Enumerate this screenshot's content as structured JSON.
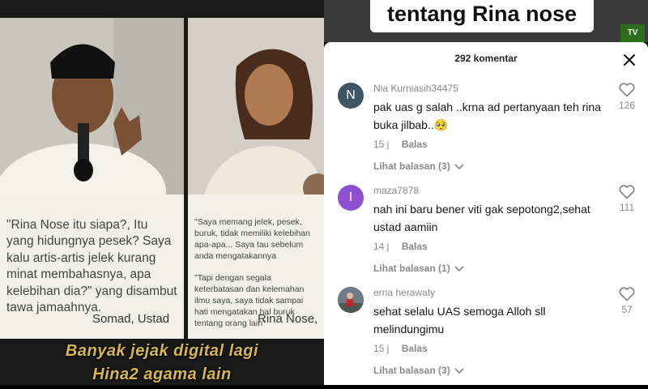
{
  "video": {
    "left_caption": "\"Rina Nose itu siapa?, Itu yang hidungnya pesek? Saya kalu artis-artis jelek kurang minat membahasnya, apa kelebihan dia?\" yang disambut tawa jamaahnya.",
    "left_credit": "Somad, Ustad",
    "right_caption_1": "\"Saya memang jelek, pesek, buruk, tidak memiliki kelebihan apa-apa... Saya tau sebelum anda mengatakannya",
    "right_caption_2": "\"Tapi dengan segala keterbatasan dan kelemahan ilmu saya, saya tidak sampai hati mengatakan hal buruk tentang orang lain\"",
    "right_credit": "Rina Nose,",
    "subtitles": [
      "Banyak jejak digital lagi",
      "Hina2 agama lain"
    ]
  },
  "title_overlay": "tentang Rina nose",
  "tv_logo": "TV",
  "sheet": {
    "comment_count": "292 komentar",
    "close_icon": "close-icon",
    "comments": [
      {
        "avatar_letter": "N",
        "avatar_color": "#3d5564",
        "username": "Nia Kurniasih34475",
        "text": "pak uas g salah ..krna ad pertanyaan teh rina buka jilbab..🥺",
        "time": "15 j",
        "reply": "Balas",
        "view_replies": "Lihat balasan (3)",
        "likes": "126"
      },
      {
        "avatar_letter": "I",
        "avatar_color": "#8e4fd1",
        "username": "maza7878",
        "text": "nah ini baru bener viti gak sepotong2,sehat ustad aamiin",
        "time": "14 j",
        "reply": "Balas",
        "view_replies": "Lihat balasan (1)",
        "likes": "111"
      },
      {
        "avatar_letter": "",
        "avatar_color": "#5a6a7a",
        "username": "erna herawaty",
        "text": "sehat selalu UAS semoga Alloh sll melindungimu",
        "time": "15 j",
        "reply": "Balas",
        "view_replies": "Lihat balasan (3)",
        "likes": "57"
      }
    ]
  },
  "colors": {
    "subtitle": "#d8b84c",
    "muted": "#8a8a8a"
  }
}
